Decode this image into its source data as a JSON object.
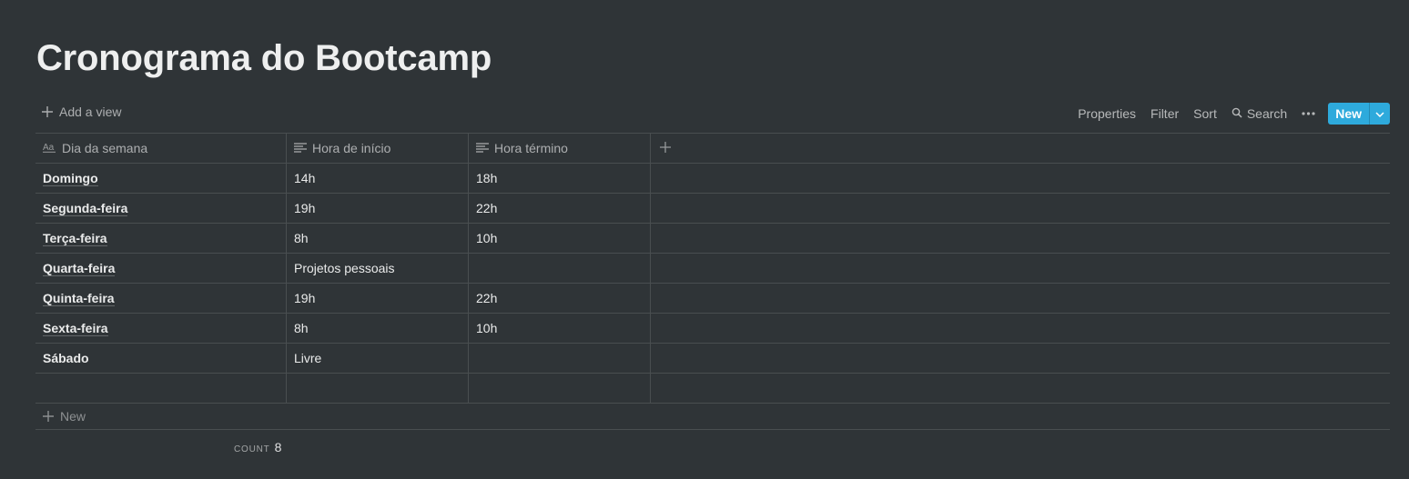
{
  "page": {
    "title": "Cronograma do Bootcamp"
  },
  "toolbar": {
    "add_view": "Add a view",
    "properties": "Properties",
    "filter": "Filter",
    "sort": "Sort",
    "search": "Search",
    "new": "New"
  },
  "table": {
    "columns": [
      {
        "label": "Dia da semana",
        "icon": "title-icon"
      },
      {
        "label": "Hora de início",
        "icon": "text-lines-icon"
      },
      {
        "label": "Hora término",
        "icon": "text-lines-icon"
      }
    ],
    "rows": [
      {
        "day": "Domingo",
        "start": "14h",
        "end": "18h"
      },
      {
        "day": "Segunda-feira",
        "start": "19h",
        "end": "22h"
      },
      {
        "day": "Terça-feira",
        "start": "8h",
        "end": "10h"
      },
      {
        "day": "Quarta-feira",
        "start": "Projetos pessoais",
        "end": ""
      },
      {
        "day": "Quinta-feira",
        "start": "19h",
        "end": "22h"
      },
      {
        "day": "Sexta-feira",
        "start": "8h",
        "end": "10h"
      },
      {
        "day": "Sábado",
        "start": "Livre",
        "end": ""
      },
      {
        "day": "",
        "start": "",
        "end": ""
      }
    ],
    "new_row": "New"
  },
  "footer": {
    "count_label": "COUNT",
    "count_value": "8"
  },
  "colors": {
    "background": "#2f3437",
    "accent": "#2eaadc"
  }
}
